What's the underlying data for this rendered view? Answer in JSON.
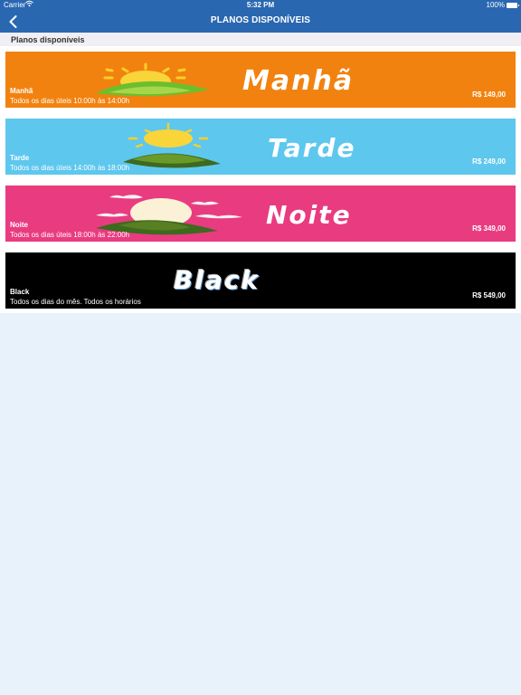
{
  "status_bar": {
    "carrier": "Carrier",
    "time": "5:32 PM",
    "battery": "100%"
  },
  "nav": {
    "title": "PLANOS DISPONÍVEIS",
    "back_icon": "chevron-left-icon"
  },
  "section": {
    "title": "Planos disponíveis"
  },
  "plans": [
    {
      "name": "Manhã",
      "description": "Todos os dias úteis 10:00h às 14:00h",
      "price": "R$ 149,00",
      "banner_word": "Manhã",
      "color": "#f2820f"
    },
    {
      "name": "Tarde",
      "description": "Todos os dias úteis 14:00h às 18:00h",
      "price": "R$ 249,00",
      "banner_word": "Tarde",
      "color": "#5ec7ee"
    },
    {
      "name": "Noite",
      "description": "Todos os dias úteis 18:00h às 22:00h",
      "price": "R$ 349,00",
      "banner_word": "Noite",
      "color": "#e93b80"
    },
    {
      "name": "Black",
      "description": "Todos os dias do mês. Todos os horários",
      "price": "R$ 549,00",
      "banner_word": "Black",
      "color": "#000000"
    }
  ],
  "colors": {
    "nav_background": "#2a67b1",
    "page_background": "#e8f2fb",
    "section_background": "#efeff4"
  }
}
